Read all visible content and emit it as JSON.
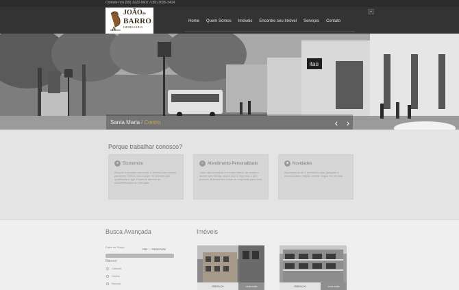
{
  "topbar": {
    "contact": "Contate-nos (55) 3222-5607 / (55) 3026-3414"
  },
  "logo": {
    "line1": "JOÃO",
    "line1_small": "de",
    "line2": "BARRO",
    "line3": "IMOBILIÁRIA"
  },
  "header": {
    "menu_toggle_icon": "menu-toggle-icon",
    "nav": [
      {
        "label": "Home"
      },
      {
        "label": "Quem Somos"
      },
      {
        "label": "Imóveis"
      },
      {
        "label": "Encontre seu Imóvel"
      },
      {
        "label": "Serviços"
      },
      {
        "label": "Contato"
      }
    ]
  },
  "hero": {
    "city": "Santa Maria",
    "separator": "/",
    "district": "Centro",
    "sign": "itaú",
    "prev_icon": "chevron-left-icon",
    "next_icon": "chevron-right-icon"
  },
  "why": {
    "title": "Porque trabalhar conosco?",
    "cards": [
      {
        "icon": "piggy-icon",
        "title": "Economize",
        "body": "Sempre buscando encontrar o melhor para nossos parceiros. Temos uma equipe de manutenção qualificada e ágil. Estamos atentos as movimentações do mercado."
      },
      {
        "icon": "search-icon",
        "title": "Atendimento Personalizado",
        "body": "Caso não encontrar em nosso banco de dados o imóvel que deseja, clique aqui e diga-nos o que procura. Buscaremos todas as respostas para você."
      },
      {
        "icon": "news-icon",
        "title": "Novidades",
        "body": "Apartamento de 1 dormitório com garagem e churrasqueira, região central. Vagas em 15 dias."
      }
    ]
  },
  "busca": {
    "title": "Busca Avançada",
    "price_label": "Faixa de Preço:",
    "price_range": "R$0 — R$3000000",
    "slider_fill": 1.0,
    "bairros_label": "Bairros:",
    "bairros": [
      "Camobi",
      "Centro",
      "Nonoai"
    ]
  },
  "imoveis": {
    "title": "Imóveis",
    "items": [
      {
        "price": "R$560,00",
        "more": "Leia mais"
      },
      {
        "price": "R$900,00",
        "more": "Leia mais"
      }
    ]
  },
  "colors": {
    "header": "#333333",
    "accent": "#c7a84a",
    "background": "#e9e9e9"
  }
}
